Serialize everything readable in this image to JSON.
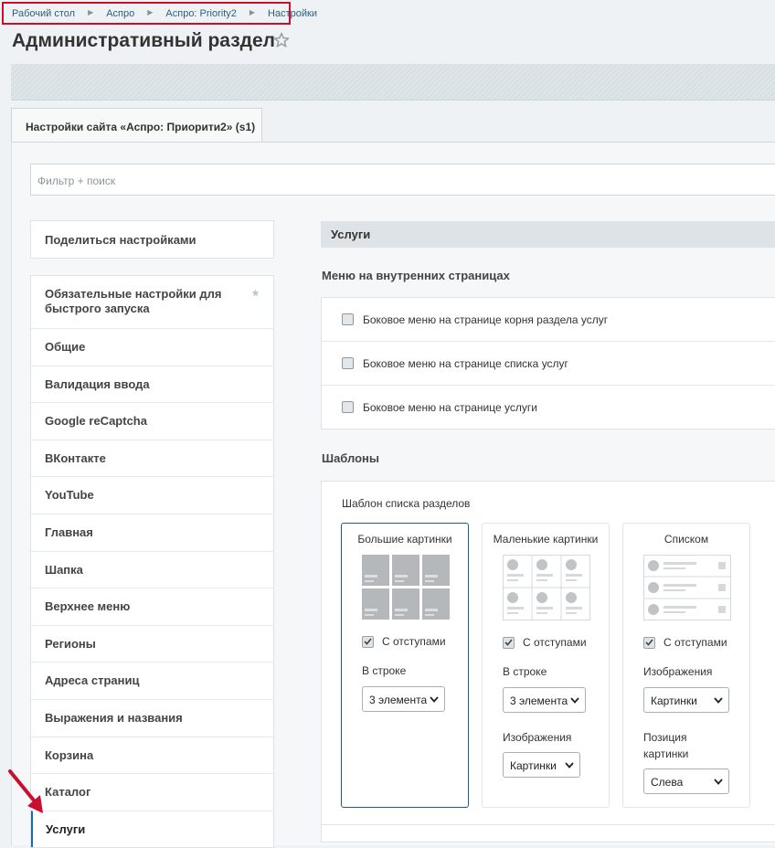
{
  "breadcrumb": [
    "Рабочий стол",
    "Аспро",
    "Аспро: Priority2",
    "Настройки"
  ],
  "page_title": "Административный раздел",
  "tab_label": "Настройки сайта «Аспро: Приорити2» (s1)",
  "filter_placeholder": "Фильтр + поиск",
  "share_label": "Поделиться настройками",
  "menu": [
    "Обязательные настройки для быстрого запуска",
    "Общие",
    "Валидация ввода",
    "Google reCaptcha",
    "ВКонтакте",
    "YouTube",
    "Главная",
    "Шапка",
    "Верхнее меню",
    "Регионы",
    "Адреса страниц",
    "Выражения и названия",
    "Корзина",
    "Каталог",
    "Услуги"
  ],
  "active_menu_item": "Услуги",
  "section": {
    "title": "Услуги",
    "menu_heading": "Меню на внутренних страницах",
    "menu_options": [
      {
        "label": "Боковое меню на странице корня раздела услуг",
        "checked": false
      },
      {
        "label": "Боковое меню на странице списка услуг",
        "checked": false
      },
      {
        "label": "Боковое меню на странице услуги",
        "checked": false
      }
    ],
    "templates_heading": "Шаблоны",
    "template_list_label": "Шаблон списка разделов",
    "cards": [
      {
        "title": "Большие картинки",
        "selected": true,
        "padding_label": "С отступами",
        "padding_checked": true,
        "row_label": "В строке",
        "row_value": "3 элемента"
      },
      {
        "title": "Маленькие картинки",
        "selected": false,
        "padding_label": "С отступами",
        "padding_checked": true,
        "row_label": "В строке",
        "row_value": "3 элемента",
        "images_label": "Изображения",
        "images_value": "Картинки"
      },
      {
        "title": "Списком",
        "selected": false,
        "padding_label": "С отступами",
        "padding_checked": true,
        "images_label": "Изображения",
        "images_value": "Картинки",
        "position_label": "Позиция картинки",
        "position_value": "Слева"
      }
    ]
  },
  "colors": {
    "highlight_border": "#c8102e",
    "arrow": "#c8102e",
    "selected_card_border": "#1f5d89",
    "link": "#2f5e7e"
  }
}
